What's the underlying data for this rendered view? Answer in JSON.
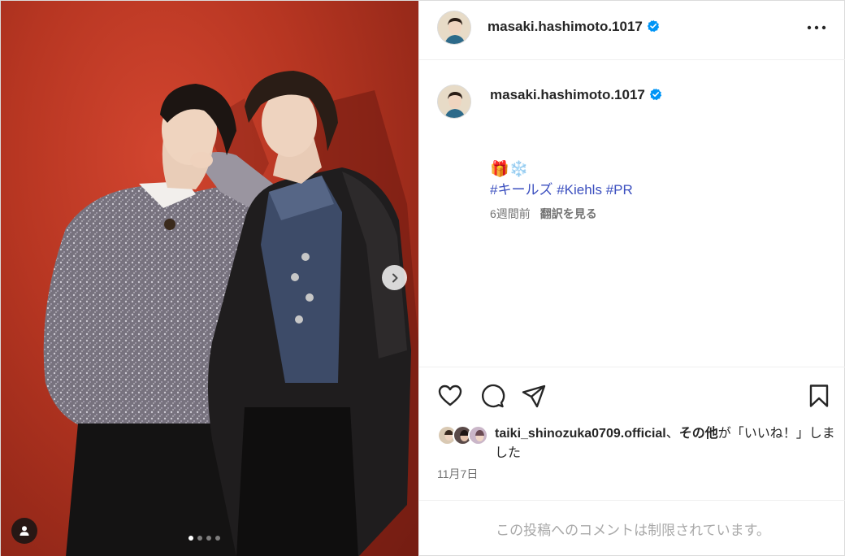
{
  "post": {
    "username": "masaki.hashimoto.1017",
    "verified": true,
    "more_label": "•••",
    "caption_emojis": "🎁❄️",
    "hashtags": [
      "#キールズ",
      "#Kiehls",
      "#PR"
    ],
    "age": "6週間前",
    "translate_label": "翻訳を見る",
    "likes_user": "taiki_shinozuka0709.official",
    "likes_sep": "、",
    "likes_others": "その他",
    "likes_suffix": "が「いいね！」しました",
    "date": "11月7日",
    "comments_disabled": "この投稿へのコメントは制限されています。"
  },
  "carousel": {
    "current": 1,
    "total": 4
  },
  "colors": {
    "accent_link": "#3b4fbf",
    "verified": "#0095f6",
    "muted": "#737373"
  },
  "icons": [
    "verified-badge-icon",
    "more-options-icon",
    "heart-icon",
    "comment-icon",
    "share-icon",
    "bookmark-icon",
    "chevron-right-icon",
    "user-tag-icon"
  ]
}
